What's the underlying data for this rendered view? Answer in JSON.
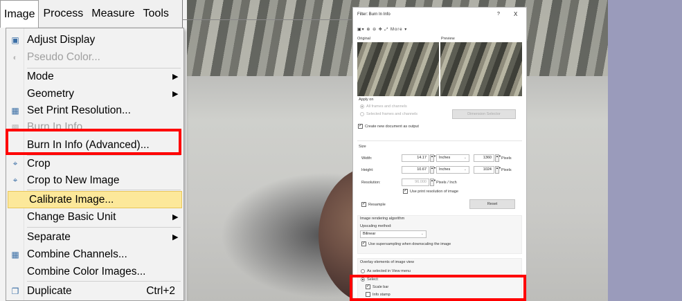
{
  "menubar": {
    "items": [
      "Image",
      "Process",
      "Measure",
      "Tools"
    ]
  },
  "menu": {
    "items": [
      {
        "label": "Adjust Display",
        "icon": "adjust-display-icon"
      },
      {
        "label": "Pseudo Color...",
        "icon": "pseudo-color-icon",
        "disabled": true
      },
      {
        "label": "Mode",
        "submenu": true
      },
      {
        "label": "Geometry",
        "submenu": true
      },
      {
        "label": "Set Print Resolution...",
        "icon": "print-resolution-icon"
      },
      {
        "label": "Burn In Info",
        "icon": "burn-in-icon",
        "disabled": true
      },
      {
        "label": "Burn In Info (Advanced)..."
      },
      {
        "label": "Crop",
        "icon": "crop-icon"
      },
      {
        "label": "Crop to New Image",
        "icon": "crop-new-icon"
      },
      {
        "label": "Calibrate Image..."
      },
      {
        "label": "Change Basic Unit",
        "submenu": true
      },
      {
        "label": "Separate",
        "submenu": true
      },
      {
        "label": "Combine Channels...",
        "icon": "combine-channels-icon"
      },
      {
        "label": "Combine Color Images..."
      },
      {
        "label": "Duplicate",
        "icon": "duplicate-icon",
        "shortcut": "Ctrl+2"
      }
    ]
  },
  "dialog": {
    "title": "Filter: Burn In Info",
    "help": "?",
    "close": "X",
    "toolbar_more": "More ▾",
    "original_label": "Original",
    "preview_label": "Preview",
    "apply_on": {
      "heading": "Apply on",
      "all_frames": "All frames and channels",
      "selected_frames": "Selected frames and channels",
      "dimension_selector": "Dimension Selector",
      "create_new": "Create new document as output"
    },
    "size": {
      "heading": "Size",
      "width_label": "Width:",
      "width_value": "14.17",
      "width_unit": "Inches",
      "width_pixels": "1360",
      "height_label": "Height:",
      "height_value": "10.67",
      "height_unit": "Inches",
      "height_pixels": "1024",
      "pixels_label": "Pixels",
      "resolution_label": "Resolution:",
      "resolution_value": "96.000",
      "resolution_unit": "Pixels / Inch",
      "use_print_resolution": "Use print resolution of image",
      "resample": "Resample",
      "reset": "Reset"
    },
    "rendering": {
      "heading": "Image rendering algorithm",
      "upscaling_label": "Upscaling method:",
      "upscaling_value": "Bilinear",
      "supersampling": "Use supersampling when downscaling the image"
    },
    "overlay": {
      "heading": "Overlay elements of image view",
      "as_selected": "As selected in View menu",
      "select": "Select:",
      "scale_bar": "Scale bar",
      "info_stamp": "Info stamp"
    }
  }
}
